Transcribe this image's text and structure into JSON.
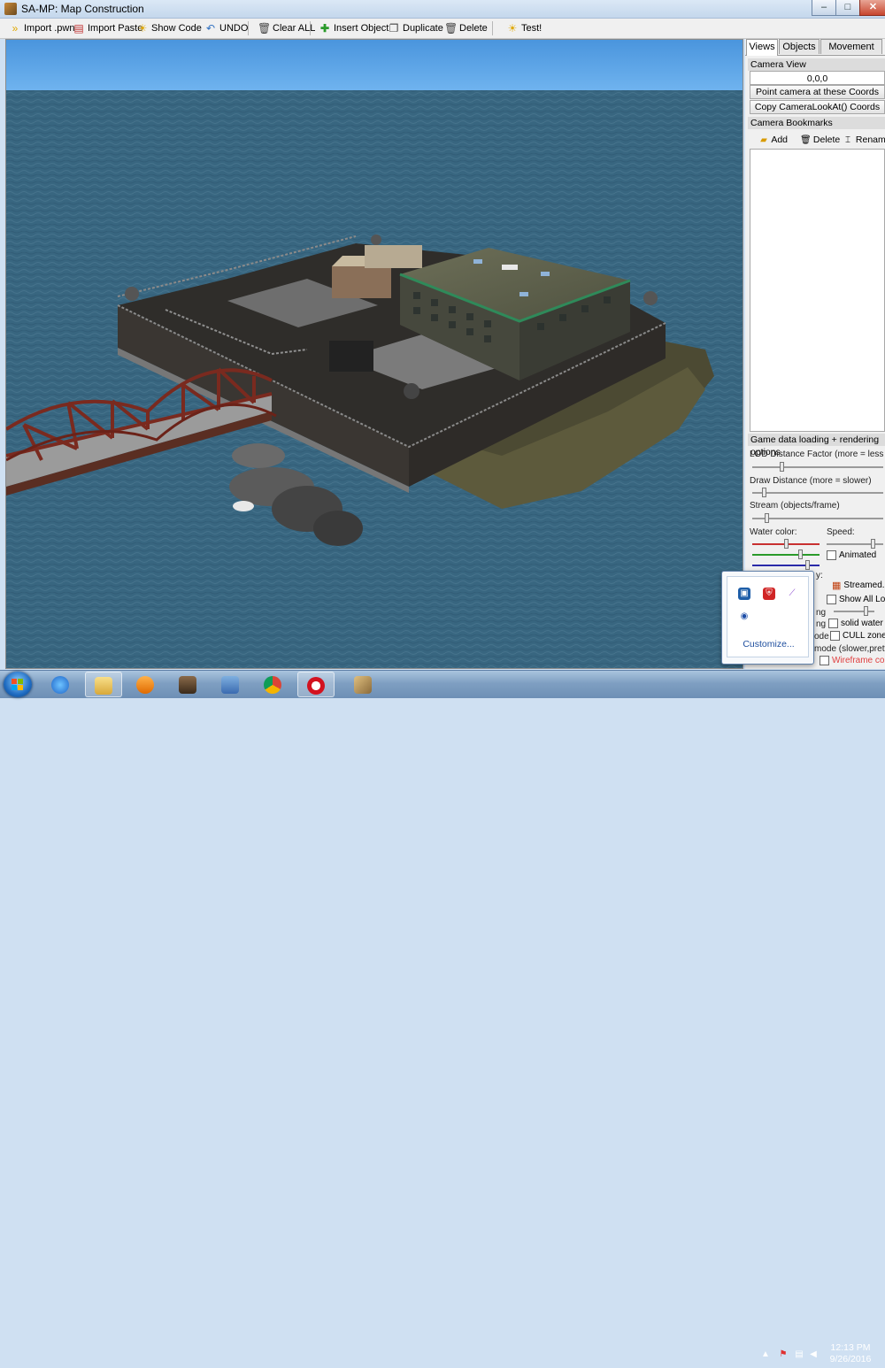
{
  "window": {
    "title": "SA-MP: Map Construction",
    "controls": {
      "minimize": "–",
      "maximize": "□",
      "close": "✕"
    }
  },
  "toolbar": {
    "import_pwn": "Import .pwn",
    "import_paste": "Import Paste",
    "show_code": "Show Code",
    "undo": "UNDO",
    "clear_all": "Clear ALL",
    "insert_object": "Insert Object",
    "duplicate": "Duplicate",
    "delete": "Delete",
    "test": "Test!"
  },
  "panel": {
    "tabs": [
      {
        "label": "Views",
        "active": true
      },
      {
        "label": "Objects",
        "active": false
      },
      {
        "label": "Movement",
        "active": false
      }
    ],
    "camera_view": {
      "header": "Camera View",
      "coords": "0,0,0",
      "point_button": "Point camera at these Coords",
      "copy_button": "Copy CameraLookAt() Coords"
    },
    "bookmarks": {
      "header": "Camera Bookmarks",
      "add": "Add",
      "delete": "Delete",
      "rename": "Rename"
    },
    "game_options": {
      "header": "Game data loading + rendering options",
      "lod_label": "LOD Distance Factor (more = less LODs)",
      "lod_level": 0.22,
      "draw_label": "Draw Distance (more = slower)",
      "draw_level": 0.08,
      "stream_label": "Stream (objects/frame)",
      "stream_level": 0.1,
      "water_color_label": "Water color:",
      "speed_label": "Speed:",
      "animated_label": "Animated",
      "streamed_label": "Streamed..",
      "show_all_lods_label": "Show All Lods",
      "solid_water_label": "solid water",
      "cull_zones_label": "CULL zones",
      "partial_ng_1": "ng",
      "partial_ng_2": "ng",
      "partial_ode": "ode",
      "partial_mode": "mode (slower,prettier)",
      "partial_y": "y:",
      "wireframe_label": "Wireframe colls"
    }
  },
  "tray_popup": {
    "customize": "Customize..."
  },
  "taskbar": {
    "time": "12:13 PM",
    "date": "9/26/2016"
  },
  "colors": {
    "sky": "#5aa0e0",
    "water": "#3f6f8a",
    "taskbar": "#7f9fc2",
    "link": "#1e4e9e"
  }
}
